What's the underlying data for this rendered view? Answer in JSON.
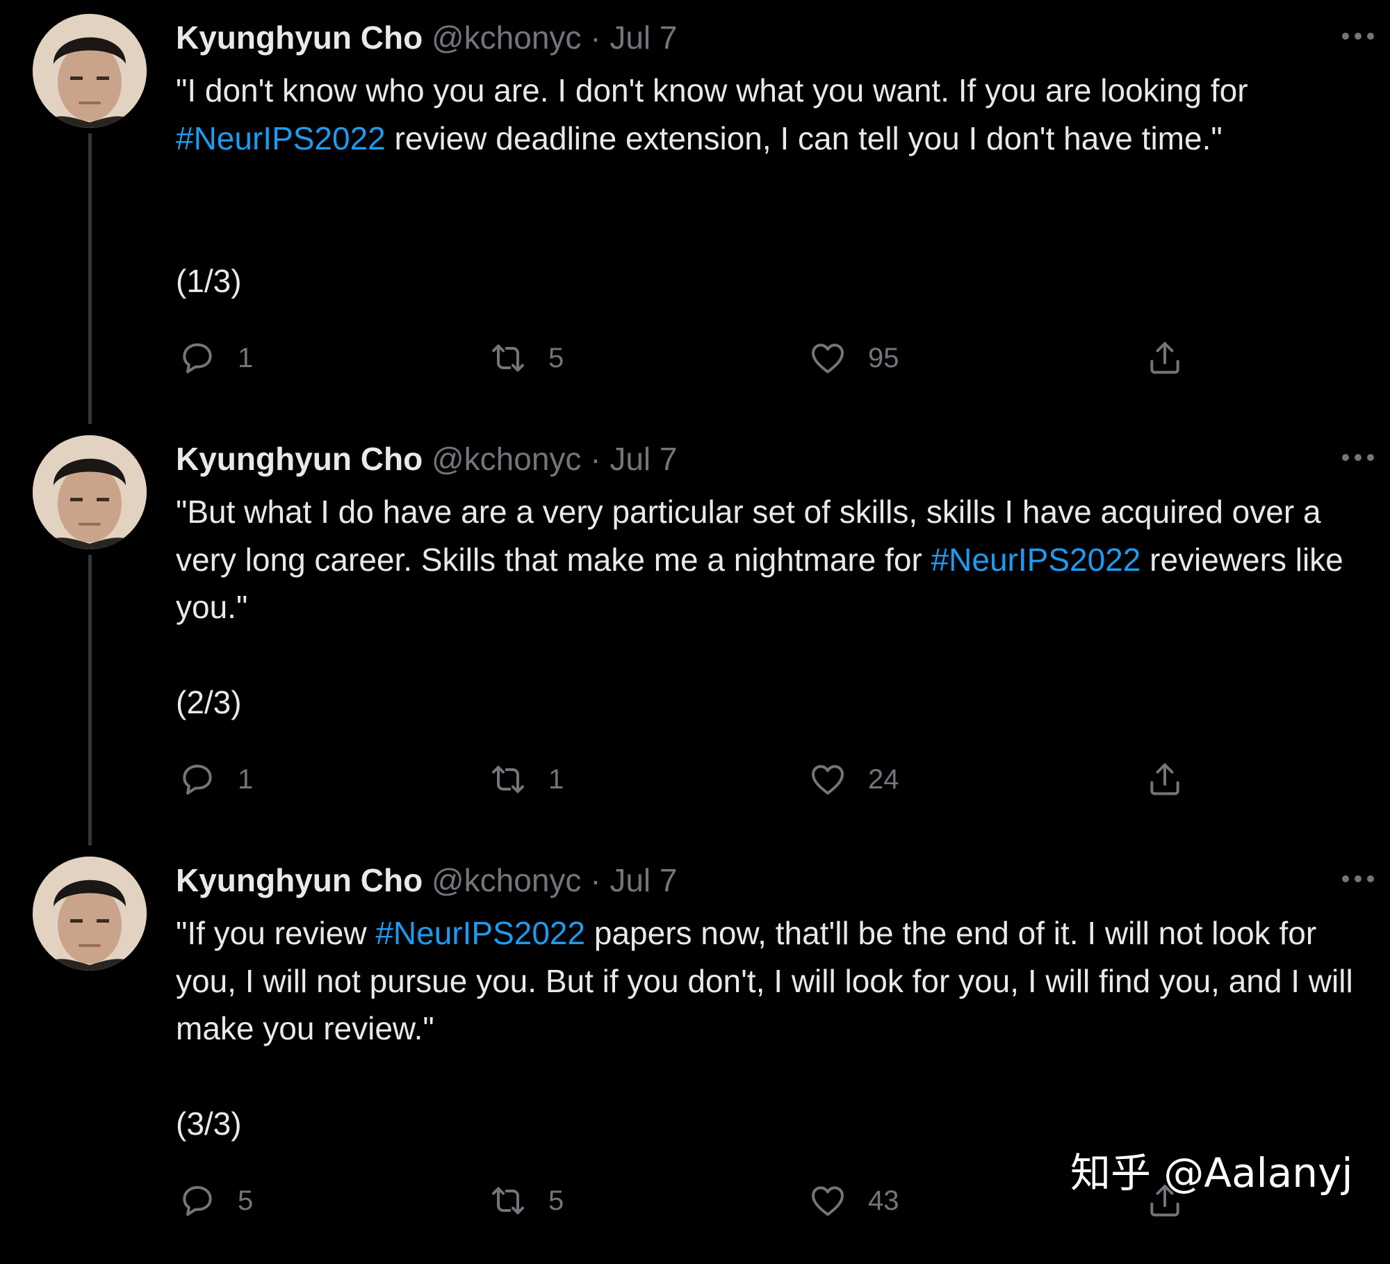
{
  "tweets": [
    {
      "author_name": "Kyunghyun Cho",
      "handle": "@kchonyc",
      "separator": "·",
      "date": "Jul 7",
      "text_parts": [
        "\"I don't know who you are. I don't know what you want. If you are looking for ",
        "#NeurIPS2022",
        " review deadline extension, I can tell you I don't have time.\""
      ],
      "counter": "(1/3)",
      "replies": "1",
      "retweets": "5",
      "likes": "95",
      "has_thread_line": true
    },
    {
      "author_name": "Kyunghyun Cho",
      "handle": "@kchonyc",
      "separator": "·",
      "date": "Jul 7",
      "text_parts": [
        "\"But what I do have are a very particular set of skills, skills I have acquired over a very long career. Skills that make me a nightmare for ",
        "#NeurIPS2022",
        " reviewers like you.\""
      ],
      "counter": "(2/3)",
      "replies": "1",
      "retweets": "1",
      "likes": "24",
      "has_thread_line": true
    },
    {
      "author_name": "Kyunghyun Cho",
      "handle": "@kchonyc",
      "separator": "·",
      "date": "Jul 7",
      "text_parts": [
        "\"If you review ",
        "#NeurIPS2022",
        " papers now, that'll be the end of it. I will not look for you, I will not pursue you. But if you don't, I will look for you, I will find you, and I will make you review.\""
      ],
      "counter": "(3/3)",
      "replies": "5",
      "retweets": "5",
      "likes": "43",
      "has_thread_line": false
    }
  ],
  "watermark": "知乎 @Aalanyj",
  "colors": {
    "background": "#000000",
    "text_primary": "#e7e9ea",
    "text_secondary": "#71767b",
    "hashtag": "#1d9bf0",
    "thread_line": "#333639"
  },
  "icons": {
    "reply": "reply-icon",
    "retweet": "retweet-icon",
    "like": "heart-icon",
    "share": "share-icon",
    "more": "more-icon"
  }
}
